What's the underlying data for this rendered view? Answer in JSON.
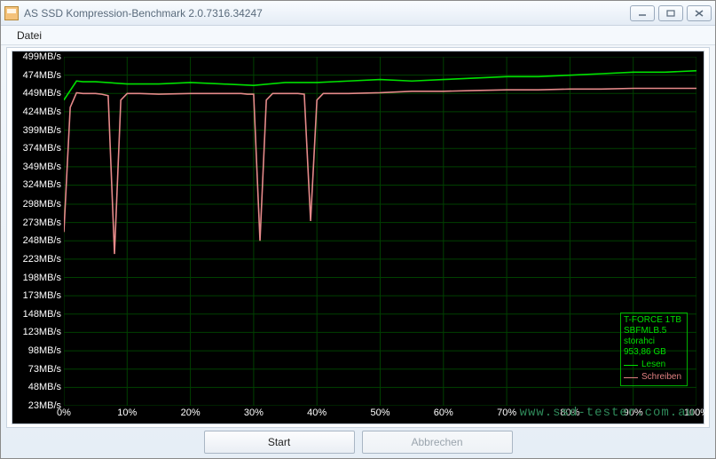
{
  "window": {
    "title": "AS SSD Kompression-Benchmark 2.0.7316.34247"
  },
  "menu": {
    "file": "Datei"
  },
  "buttons": {
    "start": "Start",
    "cancel": "Abbrechen"
  },
  "watermark": "www.ssd-tester.com.au",
  "legend": {
    "device": "T-FORCE 1TB",
    "firmware": "SBFMLB.5",
    "driver": "storahci",
    "capacity": "953,86 GB",
    "read_label": "Lesen",
    "write_label": "Schreiben"
  },
  "chart_data": {
    "type": "line",
    "xlabel": "",
    "ylabel": "",
    "x_unit": "%",
    "y_unit": "MB/s",
    "xlim": [
      0,
      100
    ],
    "ylim": [
      23,
      499
    ],
    "y_ticks": [
      499,
      474,
      449,
      424,
      399,
      374,
      349,
      324,
      298,
      273,
      248,
      223,
      198,
      173,
      148,
      123,
      98,
      73,
      48,
      23
    ],
    "y_tick_suffix": "MB/s",
    "x_ticks": [
      0,
      10,
      20,
      30,
      40,
      50,
      60,
      70,
      80,
      90,
      100
    ],
    "x_tick_suffix": "%",
    "series": [
      {
        "name": "Lesen",
        "color": "#00e000",
        "x": [
          0,
          2,
          3,
          5,
          10,
          15,
          20,
          25,
          30,
          35,
          40,
          45,
          50,
          55,
          60,
          65,
          70,
          75,
          80,
          85,
          90,
          95,
          100
        ],
        "values": [
          440,
          466,
          465,
          465,
          462,
          462,
          464,
          462,
          460,
          464,
          464,
          466,
          468,
          466,
          468,
          470,
          472,
          472,
          474,
          476,
          478,
          478,
          480
        ]
      },
      {
        "name": "Schreiben",
        "color": "#e68a8a",
        "x": [
          0,
          1,
          2,
          3,
          4,
          5,
          6,
          7,
          8,
          9,
          10,
          12,
          15,
          20,
          25,
          28,
          29,
          30,
          31,
          32,
          33,
          36,
          37,
          38,
          39,
          40,
          41,
          42,
          43,
          45,
          50,
          55,
          60,
          65,
          70,
          75,
          80,
          85,
          90,
          95,
          100
        ],
        "values": [
          260,
          430,
          450,
          449,
          449,
          449,
          448,
          446,
          230,
          440,
          449,
          449,
          448,
          449,
          449,
          449,
          448,
          448,
          248,
          440,
          449,
          449,
          449,
          448,
          275,
          440,
          449,
          449,
          449,
          449,
          450,
          452,
          452,
          453,
          454,
          454,
          455,
          455,
          456,
          456,
          456
        ]
      }
    ]
  }
}
